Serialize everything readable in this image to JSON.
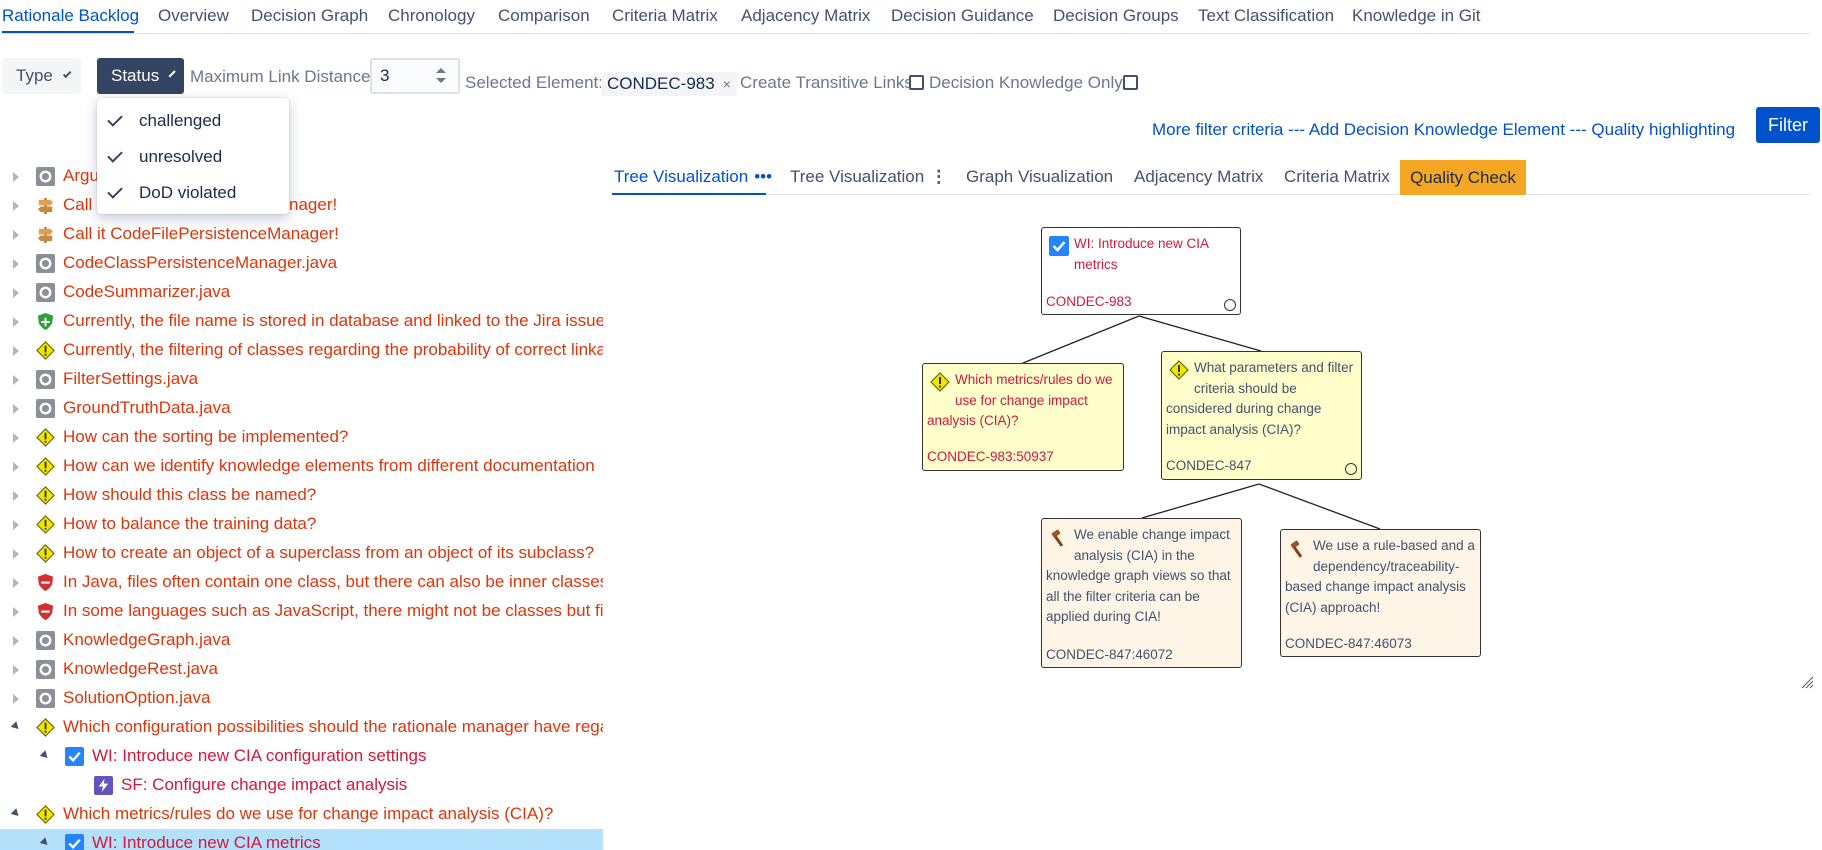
{
  "nav": {
    "items": [
      "Rationale Backlog",
      "Overview",
      "Decision Graph",
      "Chronology",
      "Comparison",
      "Criteria Matrix",
      "Adjacency Matrix",
      "Decision Guidance",
      "Decision Groups",
      "Text Classification",
      "Knowledge in Git"
    ],
    "active": "Rationale Backlog"
  },
  "filters": {
    "type_label": "Type",
    "status_label": "Status",
    "max_link_distance_label": "Maximum Link Distance",
    "max_link_distance_value": "3",
    "selected_element_label": "Selected Element:",
    "selected_element_value": "CONDEC-983",
    "chip_remove": "×",
    "create_transitive_links_label": "Create Transitive Links",
    "create_transitive_links_checked": false,
    "decision_knowledge_only_label": "Decision Knowledge Only",
    "decision_knowledge_only_checked": false
  },
  "status_menu": {
    "options": [
      {
        "label": "challenged",
        "checked": true
      },
      {
        "label": "unresolved",
        "checked": true
      },
      {
        "label": "DoD violated",
        "checked": true
      }
    ]
  },
  "links": {
    "more_filter": "More filter criteria",
    "sep": "---",
    "add_element": "Add Decision Knowledge Element",
    "quality": "Quality highlighting",
    "filter_button": "Filter"
  },
  "view_tabs": {
    "tree1": "Tree Visualization",
    "tree1_dots": "•••",
    "tree2": "Tree Visualization",
    "tree2_dots": "⋮",
    "graph": "Graph Visualization",
    "adjacency": "Adjacency Matrix",
    "criteria": "Criteria Matrix",
    "quality": "Quality Check"
  },
  "tree": [
    {
      "text": "Argu",
      "icon": "code-file-icon",
      "expanded": false,
      "level": 0
    },
    {
      "text": "Call i",
      "tail": "nager!",
      "icon": "decision-signpost-icon",
      "expanded": false,
      "level": 0
    },
    {
      "text": "Call it CodeFilePersistenceManager!",
      "icon": "decision-signpost-icon",
      "expanded": false,
      "level": 0
    },
    {
      "text": "CodeClassPersistenceManager.java",
      "icon": "code-file-icon",
      "expanded": false,
      "level": 0
    },
    {
      "text": "CodeSummarizer.java",
      "icon": "code-file-icon",
      "expanded": false,
      "level": 0
    },
    {
      "text": "Currently, the file name is stored in database and linked to the Jira issue.",
      "icon": "pro-argument-icon",
      "expanded": false,
      "level": 0
    },
    {
      "text": "Currently, the filtering of classes regarding the probability of correct linka",
      "icon": "issue-icon",
      "expanded": false,
      "level": 0
    },
    {
      "text": "FilterSettings.java",
      "icon": "code-file-icon",
      "expanded": false,
      "level": 0
    },
    {
      "text": "GroundTruthData.java",
      "icon": "code-file-icon",
      "expanded": false,
      "level": 0
    },
    {
      "text": "How can the sorting be implemented?",
      "icon": "issue-icon",
      "expanded": false,
      "level": 0
    },
    {
      "text": "How can we identify knowledge elements from different documentation",
      "icon": "issue-icon",
      "expanded": false,
      "level": 0
    },
    {
      "text": "How should this class be named?",
      "icon": "issue-icon",
      "expanded": false,
      "level": 0
    },
    {
      "text": "How to balance the training data?",
      "icon": "issue-icon",
      "expanded": false,
      "level": 0
    },
    {
      "text": "How to create an object of a superclass from an object of its subclass?",
      "icon": "issue-icon",
      "expanded": false,
      "level": 0
    },
    {
      "text": "In Java, files often contain one class, but there can also be inner classes, w",
      "icon": "con-argument-icon",
      "expanded": false,
      "level": 0
    },
    {
      "text": "In some languages such as JavaScript, there might not be classes but files",
      "icon": "con-argument-icon",
      "expanded": false,
      "level": 0
    },
    {
      "text": "KnowledgeGraph.java",
      "icon": "code-file-icon",
      "expanded": false,
      "level": 0
    },
    {
      "text": "KnowledgeRest.java",
      "icon": "code-file-icon",
      "expanded": false,
      "level": 0
    },
    {
      "text": "SolutionOption.java",
      "icon": "code-file-icon",
      "expanded": false,
      "level": 0
    },
    {
      "text": "Which configuration possibilities should the rationale manager have rega",
      "icon": "issue-icon",
      "expanded": true,
      "level": 0
    },
    {
      "text": "WI: Introduce new CIA configuration settings",
      "icon": "work-item-checkbox-icon",
      "expanded": true,
      "level": 1
    },
    {
      "text": "SF: Configure change impact analysis",
      "icon": "system-function-icon",
      "expanded": null,
      "level": 2
    },
    {
      "text": "Which metrics/rules do we use for change impact analysis (CIA)?",
      "icon": "issue-icon",
      "expanded": true,
      "level": 0
    },
    {
      "text": "WI: Introduce new CIA metrics",
      "icon": "work-item-checkbox-icon",
      "expanded": true,
      "level": 1,
      "selected": true
    }
  ],
  "graph": {
    "root": {
      "title": "WI: Introduce new CIA metrics",
      "key": "CONDEC-983"
    },
    "issue1": {
      "title": "Which metrics/rules do we use for change impact analysis (CIA)?",
      "key": "CONDEC-983:50937"
    },
    "issue2": {
      "title": "What parameters and filter criteria should be considered during change impact analysis (CIA)?",
      "key": "CONDEC-847"
    },
    "decision1": {
      "title": "We enable change impact analysis (CIA) in the knowledge graph views so that all the filter criteria can be applied during CIA!",
      "key": "CONDEC-847:46072"
    },
    "decision2": {
      "title": "We use a rule-based and a dependency/traceability-based change impact analysis (CIA) approach!",
      "key": "CONDEC-847:46073"
    }
  },
  "colors": {
    "accent": "#0052cc",
    "quality_tab": "#f5a623",
    "element_text": "#d6173b",
    "issue_node": "#ffffcc",
    "decision_node": "#fff5e6"
  }
}
